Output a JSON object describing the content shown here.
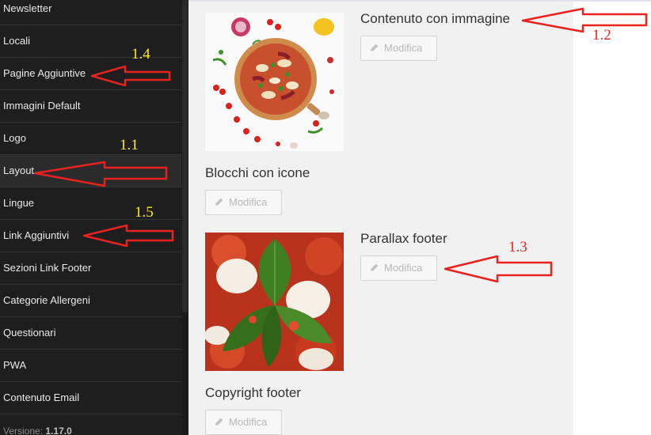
{
  "sidebar": {
    "items": [
      {
        "label": "Newsletter",
        "active": false
      },
      {
        "label": "Locali",
        "active": false
      },
      {
        "label": "Pagine Aggiuntive",
        "active": false
      },
      {
        "label": "Immagini Default",
        "active": false
      },
      {
        "label": "Logo",
        "active": false
      },
      {
        "label": "Layout",
        "active": true
      },
      {
        "label": "Lingue",
        "active": false
      },
      {
        "label": "Link Aggiuntivi",
        "active": false
      },
      {
        "label": "Sezioni Link Footer",
        "active": false
      },
      {
        "label": "Categorie Allergeni",
        "active": false
      },
      {
        "label": "Questionari",
        "active": false
      },
      {
        "label": "PWA",
        "active": false
      },
      {
        "label": "Contenuto Email",
        "active": false
      }
    ],
    "version_label": "Versione:",
    "version_value": "1.17.0"
  },
  "sections": [
    {
      "title": "Contenuto con immagine",
      "button_label": "Modifica"
    },
    {
      "title": "Blocchi con icone",
      "button_label": "Modifica"
    },
    {
      "title": "Parallax footer",
      "button_label": "Modifica"
    },
    {
      "title": "Copyright footer",
      "button_label": "Modifica"
    }
  ],
  "annotations": {
    "a1_1": "1.1",
    "a1_2": "1.2",
    "a1_3": "1.3",
    "a1_4": "1.4",
    "a1_5": "1.5"
  },
  "colors": {
    "sidebar_bg": "#1e1e1e",
    "content_bg": "#f1f1f1",
    "annotation_red": "#e8231f",
    "annotation_yellow": "#ffe81c"
  }
}
